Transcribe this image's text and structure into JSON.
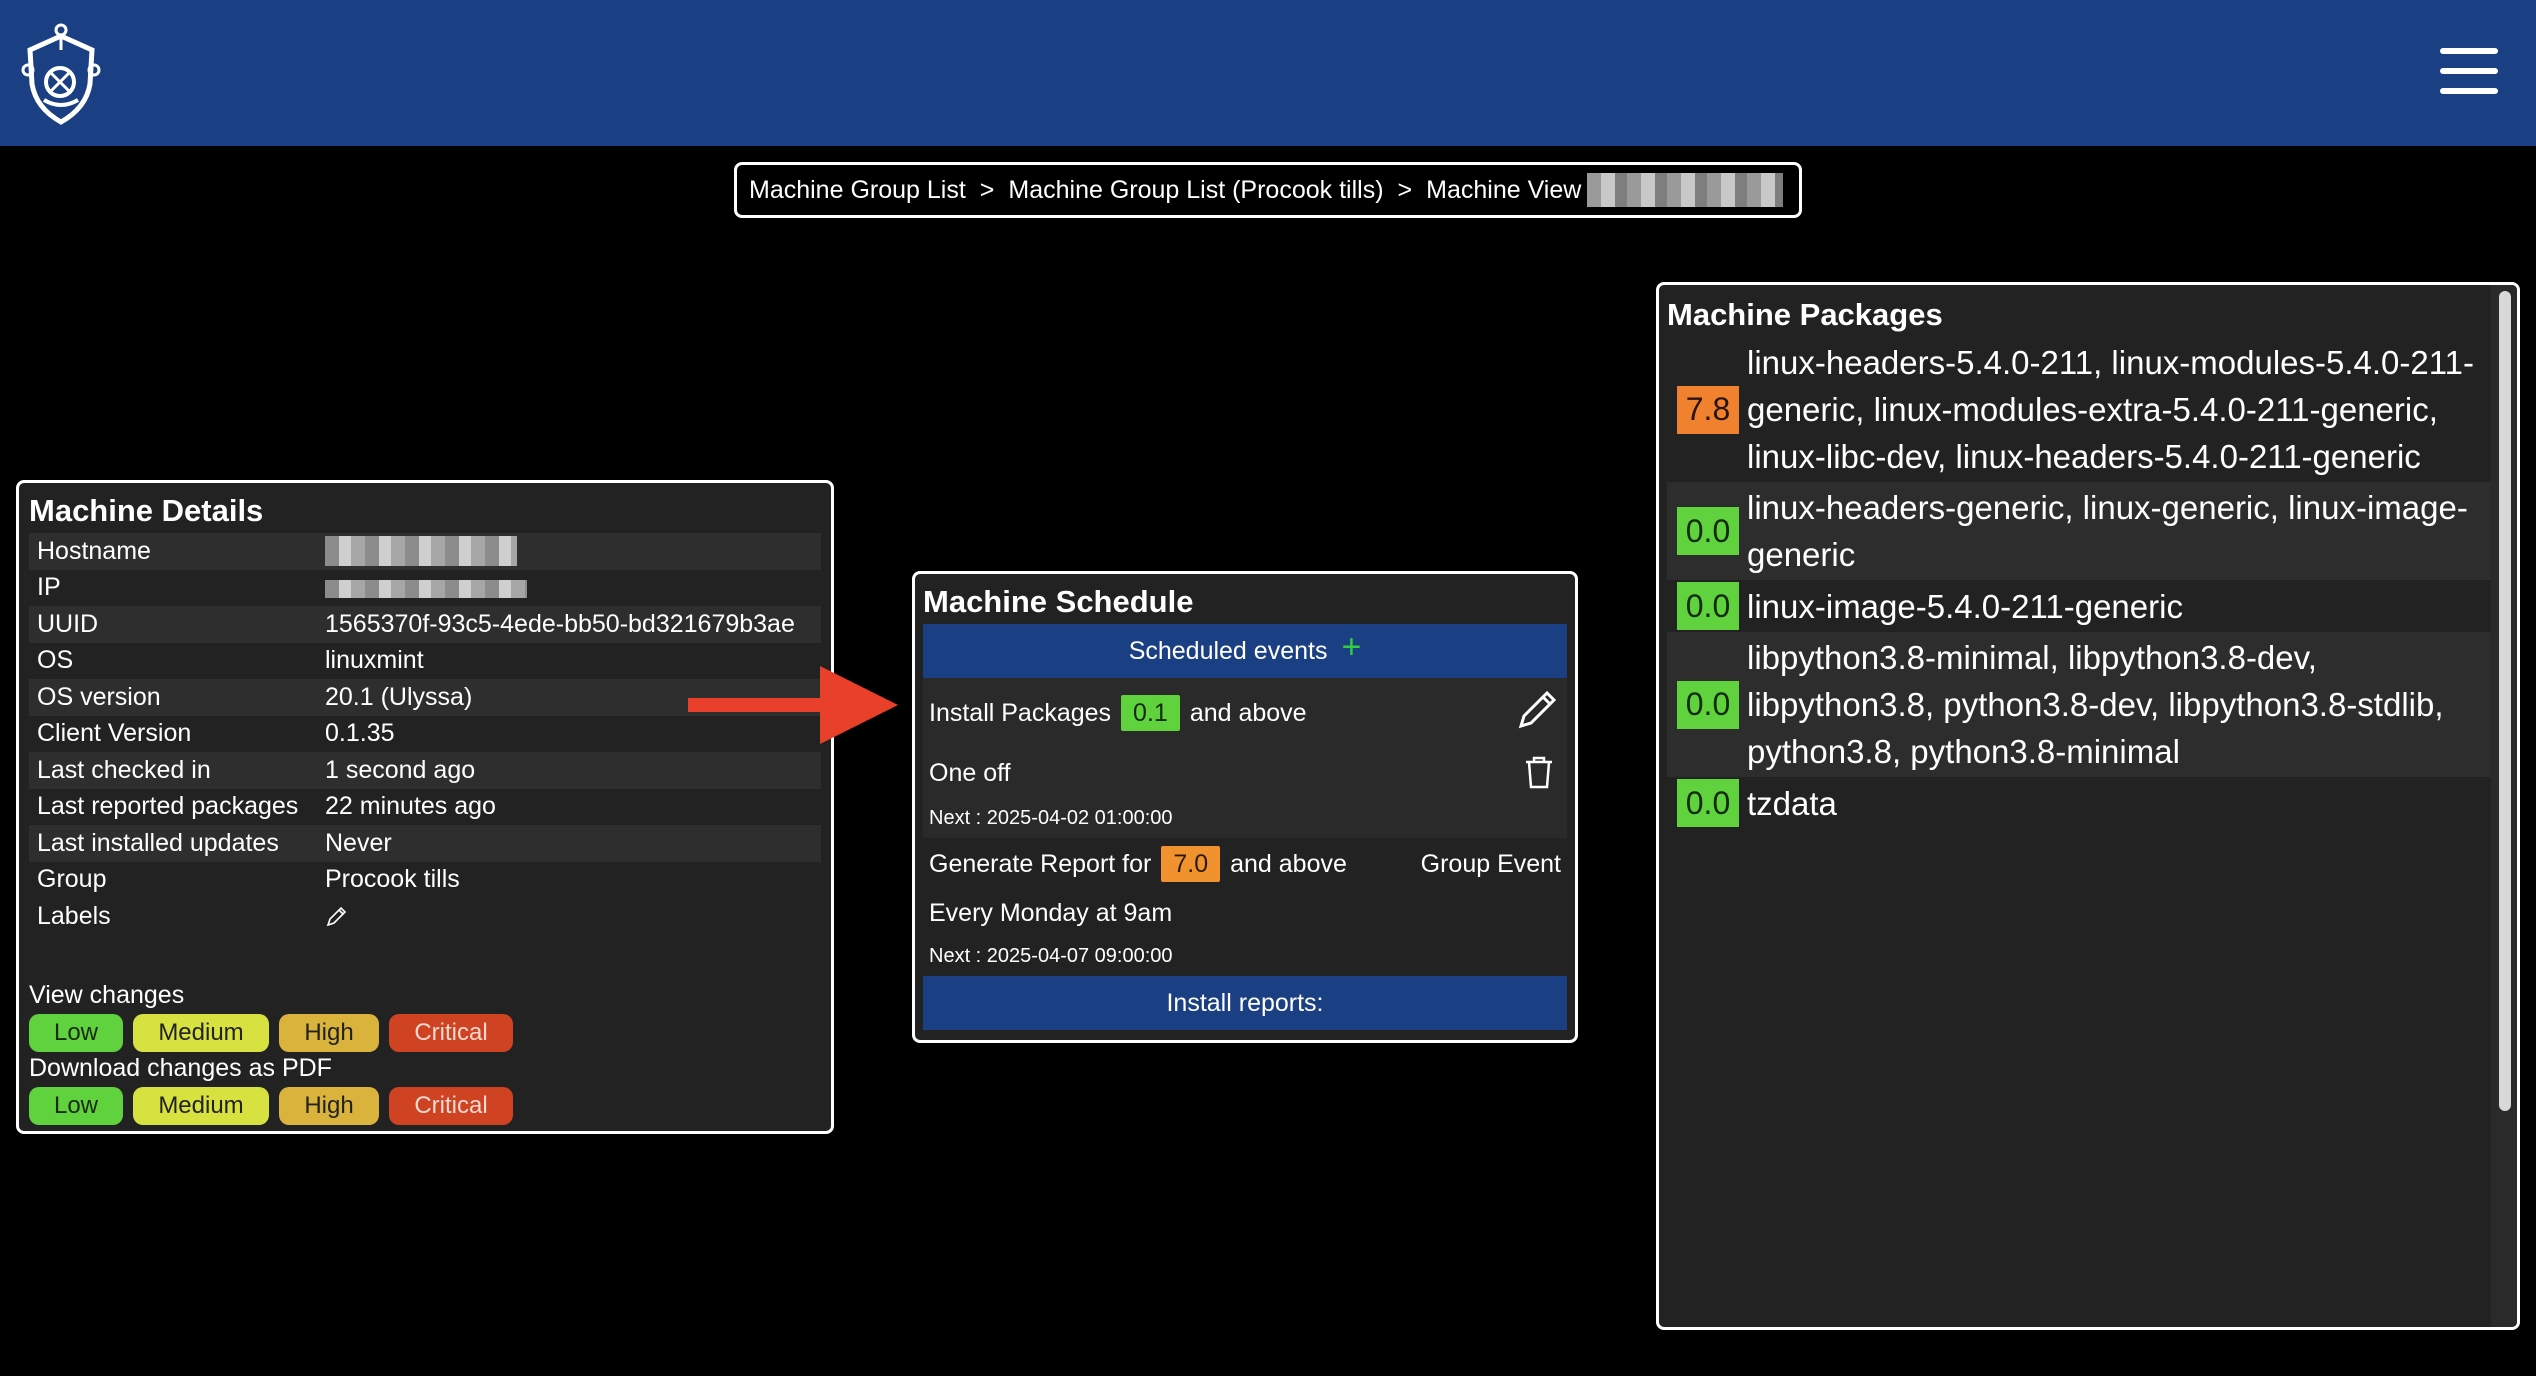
{
  "header": {
    "logo_icon": "shield-circuit-logo",
    "menu_icon": "hamburger-menu-icon",
    "bg_color": "#1b3f83"
  },
  "breadcrumb": {
    "items": [
      "Machine Group List",
      "Machine Group List (Procook tills)",
      "Machine View"
    ],
    "separator": ">"
  },
  "details": {
    "title": "Machine Details",
    "rows": [
      {
        "key": "Hostname",
        "value": ""
      },
      {
        "key": "IP",
        "value": ""
      },
      {
        "key": "UUID",
        "value": "1565370f-93c5-4ede-bb50-bd321679b3ae"
      },
      {
        "key": "OS",
        "value": "linuxmint"
      },
      {
        "key": "OS version",
        "value": "20.1 (Ulyssa)"
      },
      {
        "key": "Client Version",
        "value": "0.1.35"
      },
      {
        "key": "Last checked in",
        "value": "1 second ago"
      },
      {
        "key": "Last reported packages",
        "value": "22 minutes ago"
      },
      {
        "key": "Last installed updates",
        "value": "Never"
      },
      {
        "key": "Group",
        "value": "Procook tills"
      },
      {
        "key": "Labels",
        "value": ""
      }
    ],
    "view_changes_label": "View changes",
    "download_label": "Download changes as PDF",
    "severity": {
      "low": "Low",
      "medium": "Medium",
      "high": "High",
      "critical": "Critical"
    }
  },
  "schedule": {
    "title": "Machine Schedule",
    "scheduled_events_label": "Scheduled events",
    "add_symbol": "+",
    "event1": {
      "action": "Install Packages",
      "threshold": "0.1",
      "suffix": "and above",
      "frequency": "One off",
      "next": "Next : 2025-04-02 01:00:00"
    },
    "event2": {
      "action": "Generate Report for",
      "threshold": "7.0",
      "suffix": "and above",
      "tag": "Group Event",
      "frequency": "Every Monday at 9am",
      "next": "Next : 2025-04-07 09:00:00"
    },
    "install_reports_label": "Install reports:"
  },
  "packages": {
    "title": "Machine Packages",
    "items": [
      {
        "score": "7.8",
        "level": "orange",
        "names": "linux-headers-5.4.0-211, linux-modules-5.4.0-211-generic, linux-modules-extra-5.4.0-211-generic, linux-libc-dev, linux-headers-5.4.0-211-generic"
      },
      {
        "score": "0.0",
        "level": "green",
        "names": "linux-headers-generic, linux-generic, linux-image-generic"
      },
      {
        "score": "0.0",
        "level": "green",
        "names": "linux-image-5.4.0-211-generic"
      },
      {
        "score": "0.0",
        "level": "green",
        "names": "libpython3.8-minimal, libpython3.8-dev, libpython3.8, python3.8-dev, libpython3.8-stdlib, python3.8, python3.8-minimal"
      },
      {
        "score": "0.0",
        "level": "green",
        "names": "tzdata"
      }
    ]
  }
}
